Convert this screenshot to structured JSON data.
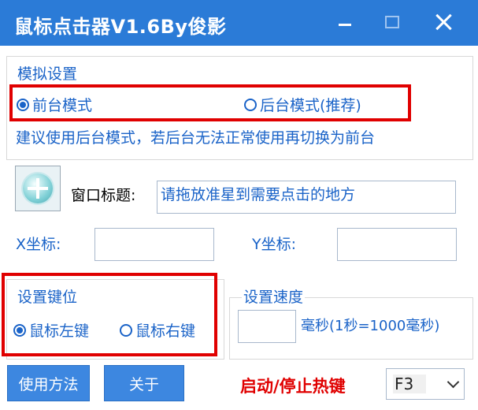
{
  "window": {
    "title": "鼠标点击器V1.6By俊影"
  },
  "simulation": {
    "legend": "模拟设置",
    "options": [
      {
        "label": "前台模式",
        "selected": true
      },
      {
        "label": "后台模式(推荐)",
        "selected": false
      }
    ],
    "hint": "建议使用后台模式，若后台无法正常使用再切换为前台"
  },
  "target": {
    "window_title_label": "窗口标题:",
    "window_title_value": "请拖放准星到需要点击的地方",
    "x_label": "X坐标:",
    "x_value": "",
    "y_label": "Y坐标:",
    "y_value": ""
  },
  "key": {
    "legend": "设置键位",
    "options": [
      {
        "label": "鼠标左键",
        "selected": true
      },
      {
        "label": "鼠标右键",
        "selected": false
      }
    ]
  },
  "speed": {
    "legend": "设置速度",
    "value": "",
    "unit_label": "毫秒(1秒=1000毫秒)"
  },
  "footer": {
    "usage_button": "使用方法",
    "about_button": "关于",
    "hotkey_label": "启动/停止热键",
    "hotkey_value": "F3"
  },
  "colors": {
    "titlebar": "#2b7bd7",
    "accent_text": "#1a63c8",
    "highlight_red": "#e00000",
    "button": "#3d87e0"
  },
  "icons": [
    "minimize-icon",
    "maximize-icon",
    "close-icon",
    "crosshair-icon",
    "chevron-down-icon"
  ]
}
